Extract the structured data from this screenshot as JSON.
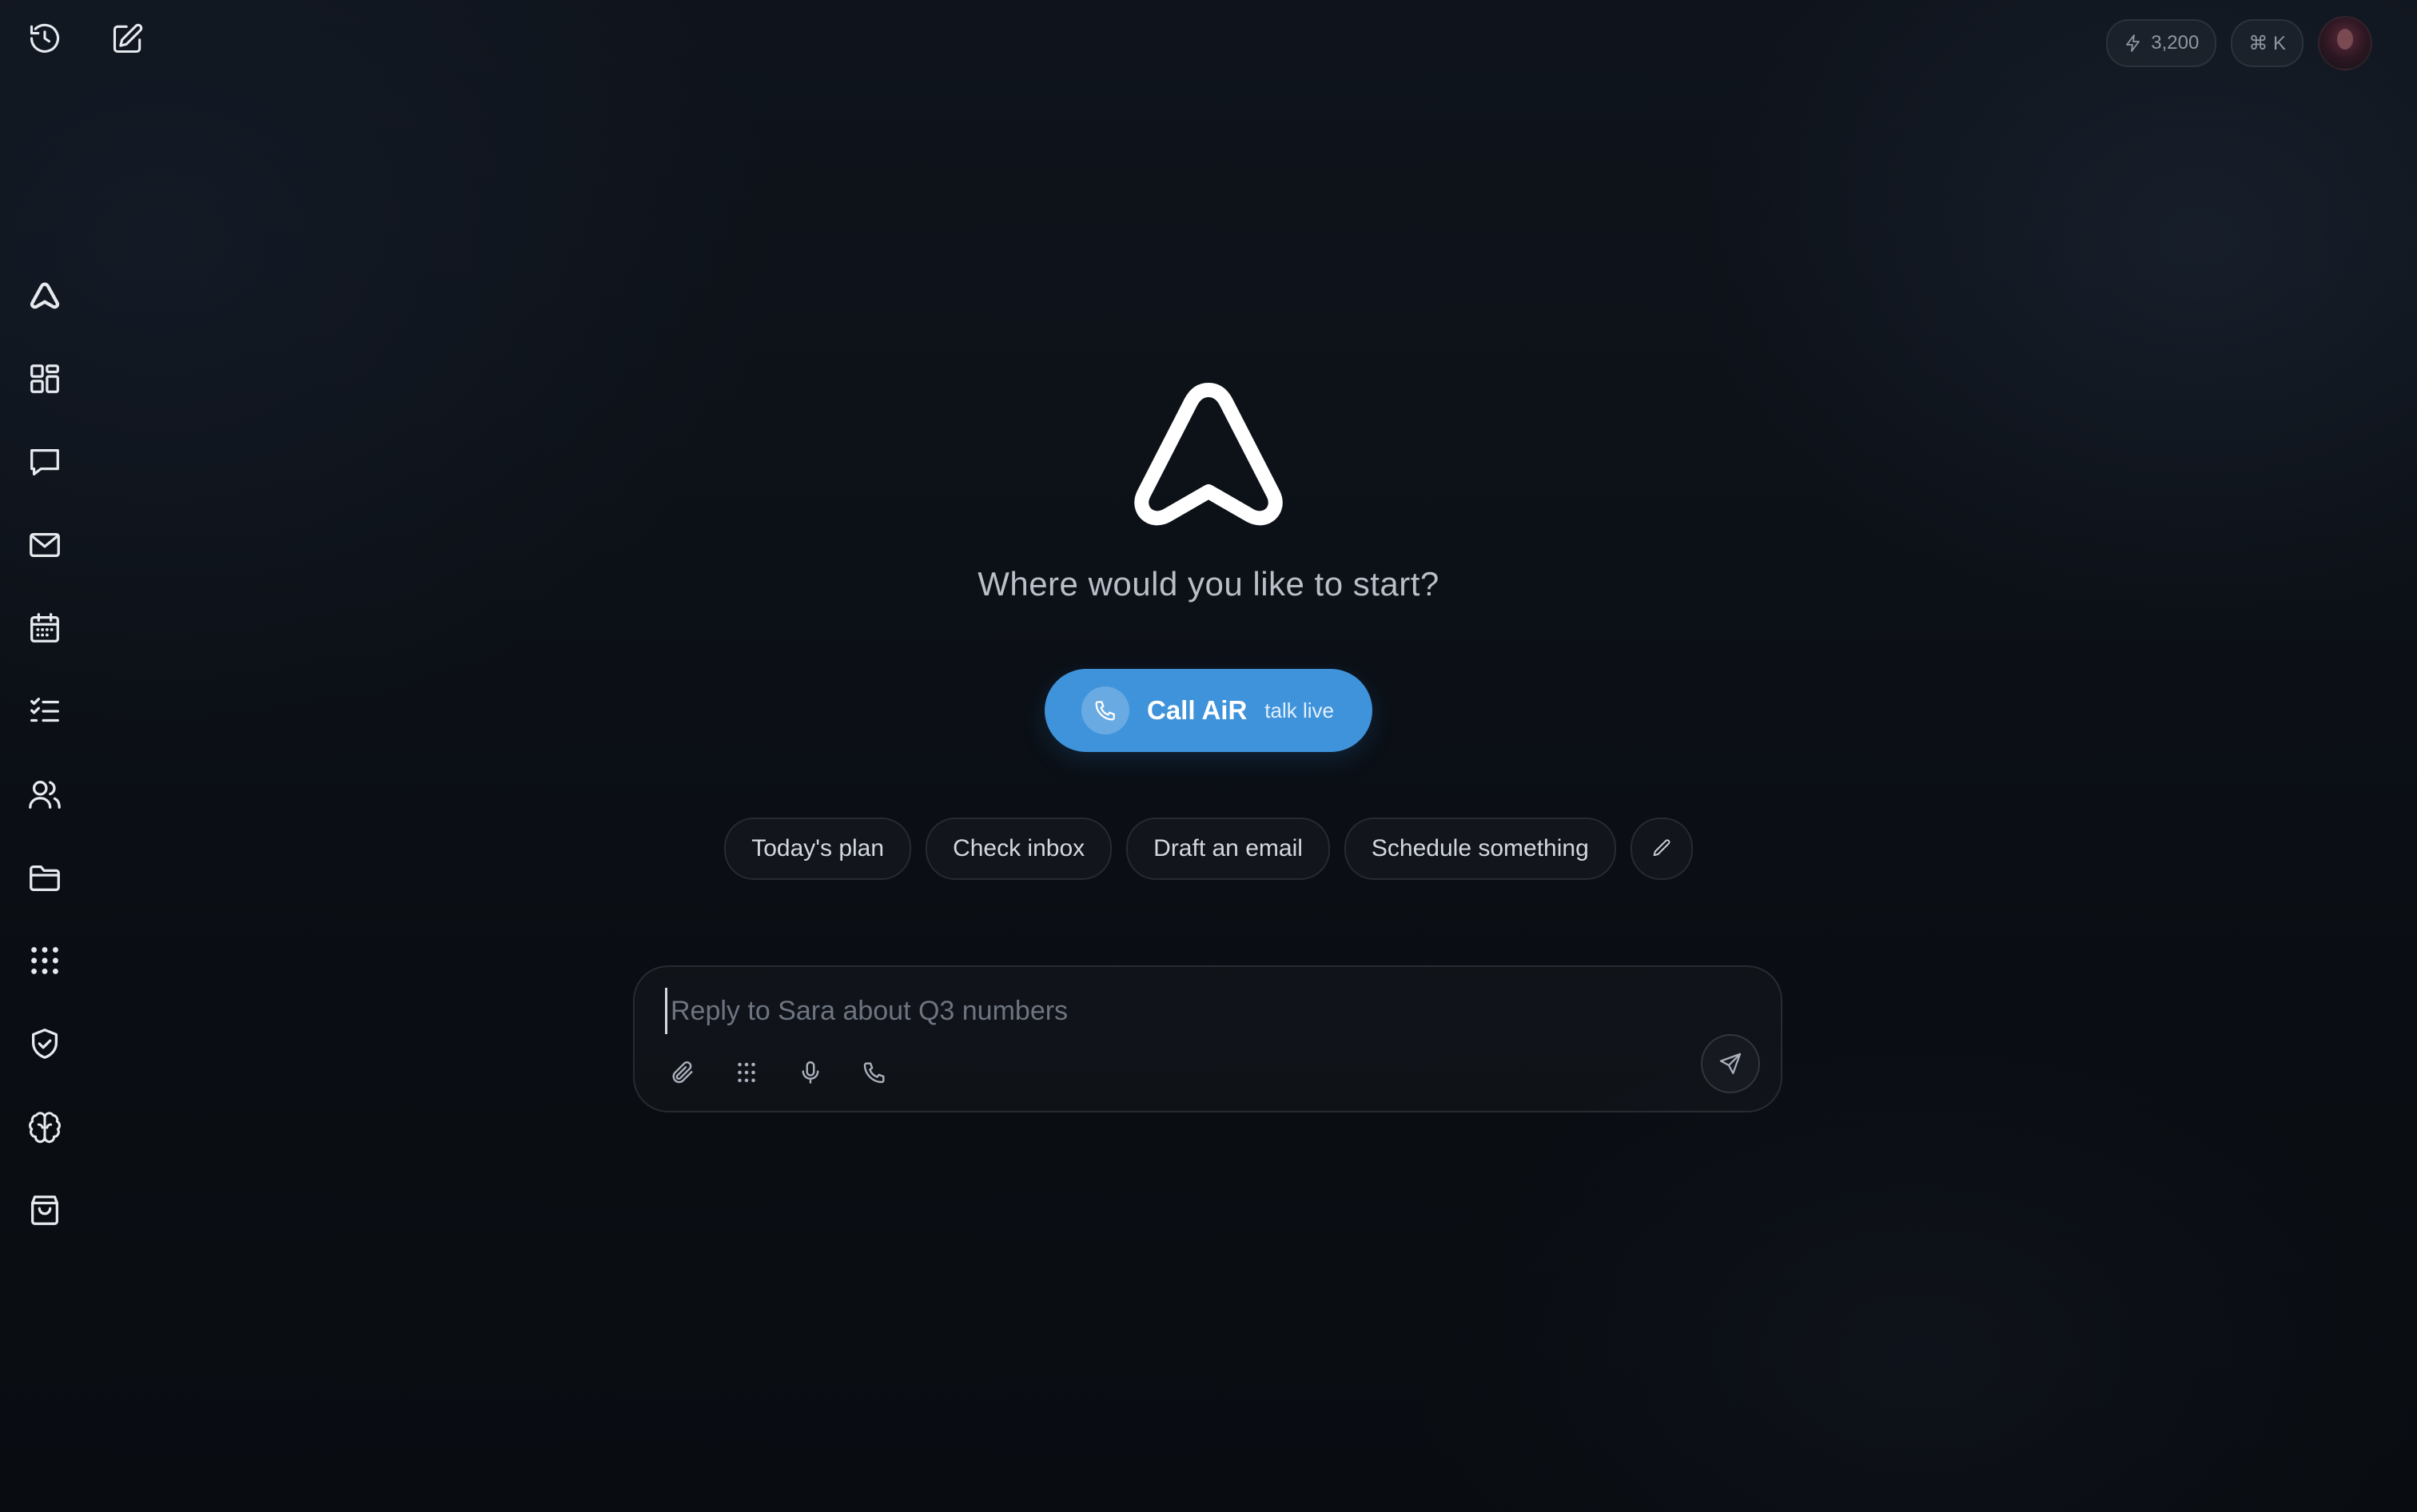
{
  "topbar": {
    "left_icons": [
      "history-icon",
      "new-chat-icon"
    ],
    "credits": "3,200",
    "shortcut": "⌘ K"
  },
  "sidebar": {
    "items": [
      {
        "icon": "air-logo-icon"
      },
      {
        "icon": "dashboard-icon"
      },
      {
        "icon": "chat-icon"
      },
      {
        "icon": "mail-icon"
      },
      {
        "icon": "calendar-icon"
      },
      {
        "icon": "tasks-icon"
      },
      {
        "icon": "contacts-icon"
      },
      {
        "icon": "folder-icon"
      },
      {
        "icon": "apps-grid-icon"
      },
      {
        "icon": "shield-check-icon"
      },
      {
        "icon": "brain-icon"
      },
      {
        "icon": "shopping-bag-icon"
      }
    ]
  },
  "main": {
    "heading": "Where would you like to start?",
    "call_button": {
      "label": "Call AiR",
      "sublabel": "talk live"
    },
    "chips": [
      "Today's plan",
      "Check inbox",
      "Draft an email",
      "Schedule something"
    ]
  },
  "composer": {
    "placeholder": "Reply to Sara about Q3 numbers",
    "value": ""
  },
  "colors": {
    "background": "#0d1118",
    "accent": "#3f93db"
  }
}
